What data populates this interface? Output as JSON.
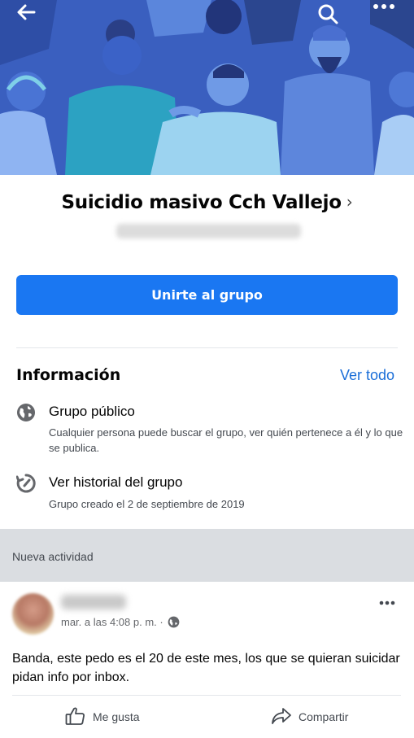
{
  "header": {
    "back_icon": "arrow-left-icon",
    "search_icon": "search-icon",
    "more_icon": "more-horizontal-icon"
  },
  "group": {
    "name": "Suicidio masivo Cch Vallejo",
    "name_chevron": "›",
    "join_label": "Unirte al grupo"
  },
  "info": {
    "heading": "Información",
    "see_all": "Ver todo",
    "items": [
      {
        "icon": "globe-icon",
        "title": "Grupo público",
        "description": "Cualquier persona puede buscar el grupo, ver quién pertenece a él y lo que se publica."
      },
      {
        "icon": "history-icon",
        "title": "Ver historial del grupo",
        "description": "Grupo creado el 2 de septiembre de 2019"
      }
    ]
  },
  "activity": {
    "label": "Nueva actividad"
  },
  "post": {
    "meta": "mar. a las 4:08 p. m. ·",
    "text": "Banda, este pedo es el 20 de este mes, los que se quieran suicidar pidan info por inbox.",
    "like_label": "Me gusta",
    "share_label": "Compartir"
  },
  "colors": {
    "accent": "#1a77f2",
    "link": "#1a6ed8",
    "cover": "#3e64c4",
    "band": "#dadde1"
  }
}
